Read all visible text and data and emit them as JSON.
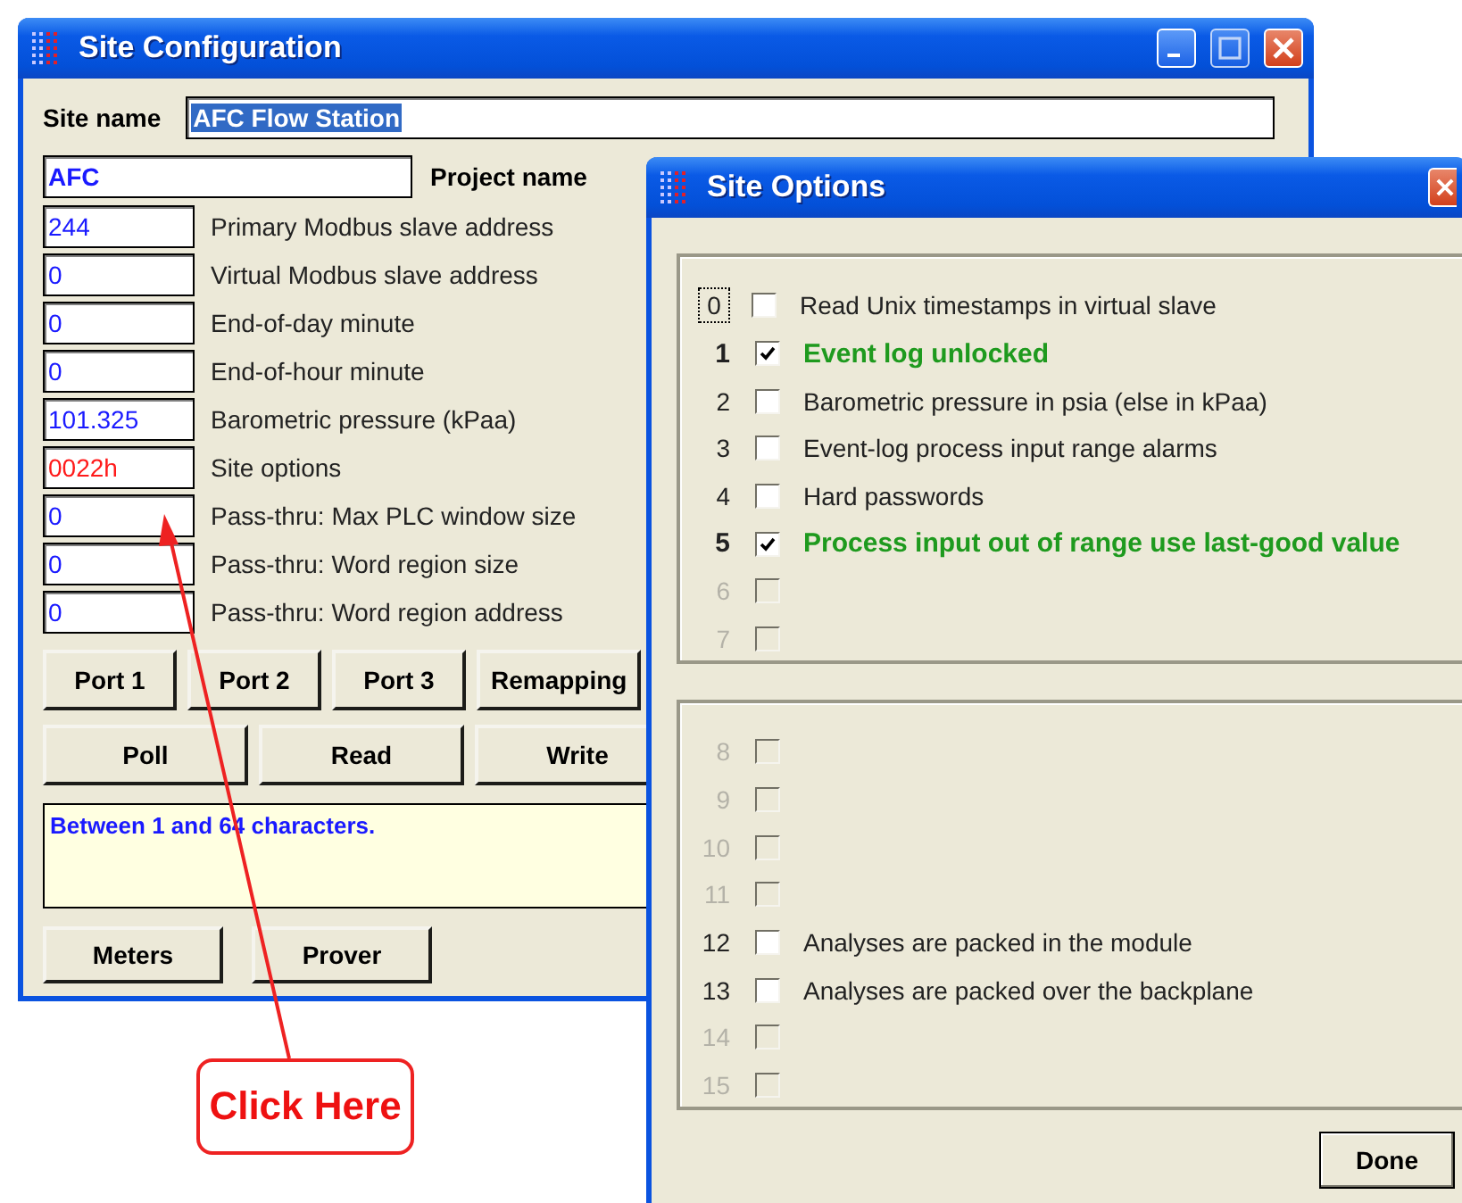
{
  "site_configuration": {
    "title": "Site Configuration",
    "site_name": {
      "label": "Site name",
      "value": "AFC Flow Station",
      "selected": true
    },
    "project": {
      "value": "AFC",
      "label": "Project name"
    },
    "fields": [
      {
        "value": "244",
        "label": "Primary Modbus slave address",
        "color": "#1a1aff"
      },
      {
        "value": "0",
        "label": "Virtual Modbus slave address",
        "color": "#1a1aff"
      },
      {
        "value": "0",
        "label": "End-of-day minute",
        "color": "#1a1aff"
      },
      {
        "value": "0",
        "label": "End-of-hour minute",
        "color": "#1a1aff"
      },
      {
        "value": "101.325",
        "label": "Barometric pressure (kPaa)",
        "color": "#1a1aff"
      },
      {
        "value": "0022h",
        "label": "Site options",
        "color": "#ff1a1a"
      },
      {
        "value": "0",
        "label": "Pass-thru: Max PLC window size",
        "color": "#1a1aff"
      },
      {
        "value": "0",
        "label": "Pass-thru: Word region size",
        "color": "#1a1aff"
      },
      {
        "value": "0",
        "label": "Pass-thru: Word region address",
        "color": "#1a1aff"
      }
    ],
    "button_rows": [
      [
        "Port 1",
        "Port 2",
        "Port 3",
        "Remapping"
      ],
      [
        "Poll",
        "Read",
        "Write"
      ]
    ],
    "message": "Between 1 and 64 characters.",
    "bottom_buttons": [
      "Meters",
      "Prover"
    ]
  },
  "site_options": {
    "title": "Site Options",
    "groups": [
      [
        {
          "number": "0",
          "label": "Read Unix timestamps in virtual slave",
          "checked": false,
          "disabled": false,
          "focused": true
        },
        {
          "number": "1",
          "label": "Event log unlocked",
          "checked": true,
          "disabled": false,
          "focused": false
        },
        {
          "number": "2",
          "label": "Barometric pressure in psia (else in kPaa)",
          "checked": false,
          "disabled": false,
          "focused": false
        },
        {
          "number": "3",
          "label": "Event-log process input range alarms",
          "checked": false,
          "disabled": false,
          "focused": false
        },
        {
          "number": "4",
          "label": "Hard passwords",
          "checked": false,
          "disabled": false,
          "focused": false
        },
        {
          "number": "5",
          "label": "Process input out of range use last-good value",
          "checked": true,
          "disabled": false,
          "focused": false
        },
        {
          "number": "6",
          "checked": false,
          "disabled": true,
          "focused": false
        },
        {
          "number": "7",
          "checked": false,
          "disabled": true,
          "focused": false
        }
      ],
      [
        {
          "number": "8",
          "checked": false,
          "disabled": true,
          "focused": false
        },
        {
          "number": "9",
          "checked": false,
          "disabled": true,
          "focused": false
        },
        {
          "number": "10",
          "checked": false,
          "disabled": true,
          "focused": false
        },
        {
          "number": "11",
          "checked": false,
          "disabled": true,
          "focused": false
        },
        {
          "number": "12",
          "label": "Analyses are packed in the module",
          "checked": false,
          "disabled": false,
          "focused": false
        },
        {
          "number": "13",
          "label": "Analyses are packed over the backplane",
          "checked": false,
          "disabled": false,
          "focused": false
        },
        {
          "number": "14",
          "checked": false,
          "disabled": true,
          "focused": false
        },
        {
          "number": "15",
          "checked": false,
          "disabled": true,
          "focused": false
        }
      ]
    ],
    "done_button": "Done"
  },
  "callout": {
    "text": "Click Here"
  }
}
